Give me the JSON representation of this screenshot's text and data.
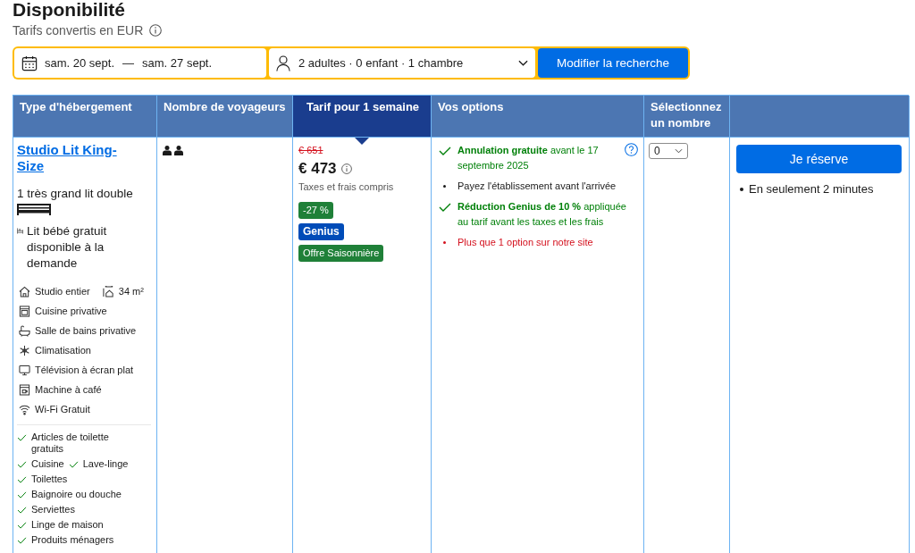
{
  "page": {
    "title": "Disponibilité",
    "subtitle": "Tarifs convertis en EUR"
  },
  "search_bar": {
    "checkin": "sam. 20 sept.",
    "separator": "—",
    "checkout": "sam. 27 sept.",
    "guests": "2 adultes · 0 enfant · 1 chambre",
    "button": "Modifier la recherche"
  },
  "table": {
    "columns": [
      {
        "label": "Type d'hébergement",
        "selected": false
      },
      {
        "label": "Nombre de voyageurs",
        "selected": false
      },
      {
        "label": "Tarif pour 1 semaine",
        "selected": true
      },
      {
        "label": "Vos options",
        "selected": false
      },
      {
        "label": "Sélectionnez un nombre",
        "selected": false
      }
    ],
    "rows": [
      {
        "room": {
          "name": "Studio Lit King-Size",
          "bed": "1 très grand lit double",
          "crib": "Lit bébé gratuit disponible à la demande",
          "facilities": [
            [
              {
                "kind": "home",
                "label": "Studio entier"
              },
              {
                "kind": "size",
                "label": "34 m²"
              }
            ],
            [
              {
                "kind": "kitchen",
                "label": "Cuisine privative"
              }
            ],
            [
              {
                "kind": "bathroom",
                "label": "Salle de bains privative"
              }
            ],
            [
              {
                "kind": "aircon",
                "label": "Climatisation"
              }
            ],
            [
              {
                "kind": "tv",
                "label": "Télévision à écran plat"
              }
            ],
            [
              {
                "kind": "coffee",
                "label": "Machine à café"
              }
            ],
            [
              {
                "kind": "wifi",
                "label": "Wi-Fi Gratuit"
              }
            ]
          ],
          "amenities": [
            [
              "Articles de toilette gratuits"
            ],
            [
              "Cuisine",
              "Lave-linge"
            ],
            [
              "Toilettes"
            ],
            [
              "Baignoire ou douche"
            ],
            [
              "Serviettes"
            ],
            [
              "Linge de maison"
            ],
            [
              "Produits ménagers"
            ]
          ]
        },
        "price": {
          "original": "€ 651",
          "current": "€ 473",
          "note": "Taxes et frais compris",
          "badges": [
            {
              "kind": "deal",
              "label": "-27 %"
            },
            {
              "kind": "genius",
              "label": "Genius"
            },
            {
              "kind": "deal",
              "label": "Offre Saisonnière"
            }
          ]
        },
        "options": [
          {
            "kind": "check",
            "text": "**Annulation gratuite** avant le 17 septembre 2025",
            "help": true
          },
          {
            "kind": "bullet",
            "text": "Payez l'établissement avant l'arrivée",
            "help": false
          },
          {
            "kind": "check",
            "text": "**Réduction Genius de 10 %** appliquée au tarif avant les taxes et les frais",
            "help": false
          },
          {
            "kind": "alert",
            "text": "Plus que 1 option sur notre site",
            "help": false
          }
        ],
        "quantity": "0",
        "reserve": {
          "button": "Je réserve",
          "note": "En seulement 2 minutes"
        }
      }
    ]
  }
}
